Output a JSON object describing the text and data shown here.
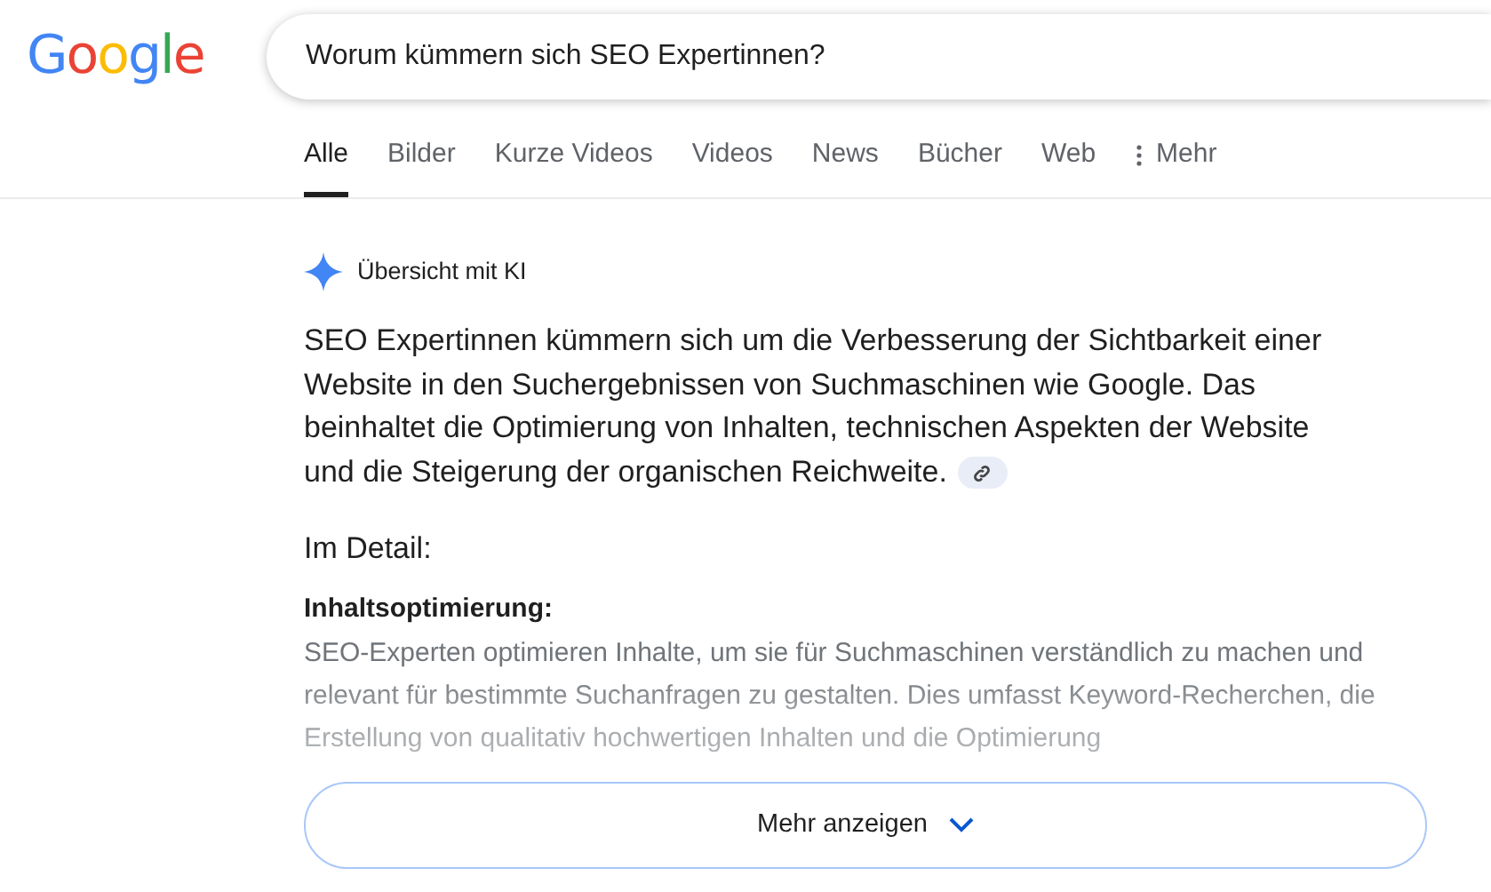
{
  "logo": "Google",
  "search": {
    "value": "Worum kümmern sich SEO Expertinnen?"
  },
  "tabs": [
    {
      "label": "Alle",
      "selected": true
    },
    {
      "label": "Bilder",
      "selected": false
    },
    {
      "label": "Kurze Videos",
      "selected": false
    },
    {
      "label": "Videos",
      "selected": false
    },
    {
      "label": "News",
      "selected": false
    },
    {
      "label": "Bücher",
      "selected": false
    },
    {
      "label": "Web",
      "selected": false
    },
    {
      "label": "Mehr",
      "selected": false,
      "kind": "menu"
    }
  ],
  "ai_overview": {
    "title": "Übersicht mit KI",
    "summary": "SEO Expertinnen kümmern sich um die Verbesserung der Sichtbarkeit einer Website in den Suchergebnissen von Suchmaschinen wie Google. Das beinhaltet die Optimierung von Inhalten, technischen Aspekten der Website und die Steigerung der organischen Reichweite.",
    "detail_heading": "Im Detail:",
    "section_heading": "Inhaltsoptimierung:",
    "section_text": "SEO-Experten optimieren Inhalte, um sie für Suchmaschinen verständlich zu machen und relevant für bestimmte Suchanfragen zu gestalten. Dies umfasst Keyword-Recherchen, die Erstellung von qualitativ hochwertigen Inhalten und die Optimierung",
    "more_button": "Mehr anzeigen"
  }
}
